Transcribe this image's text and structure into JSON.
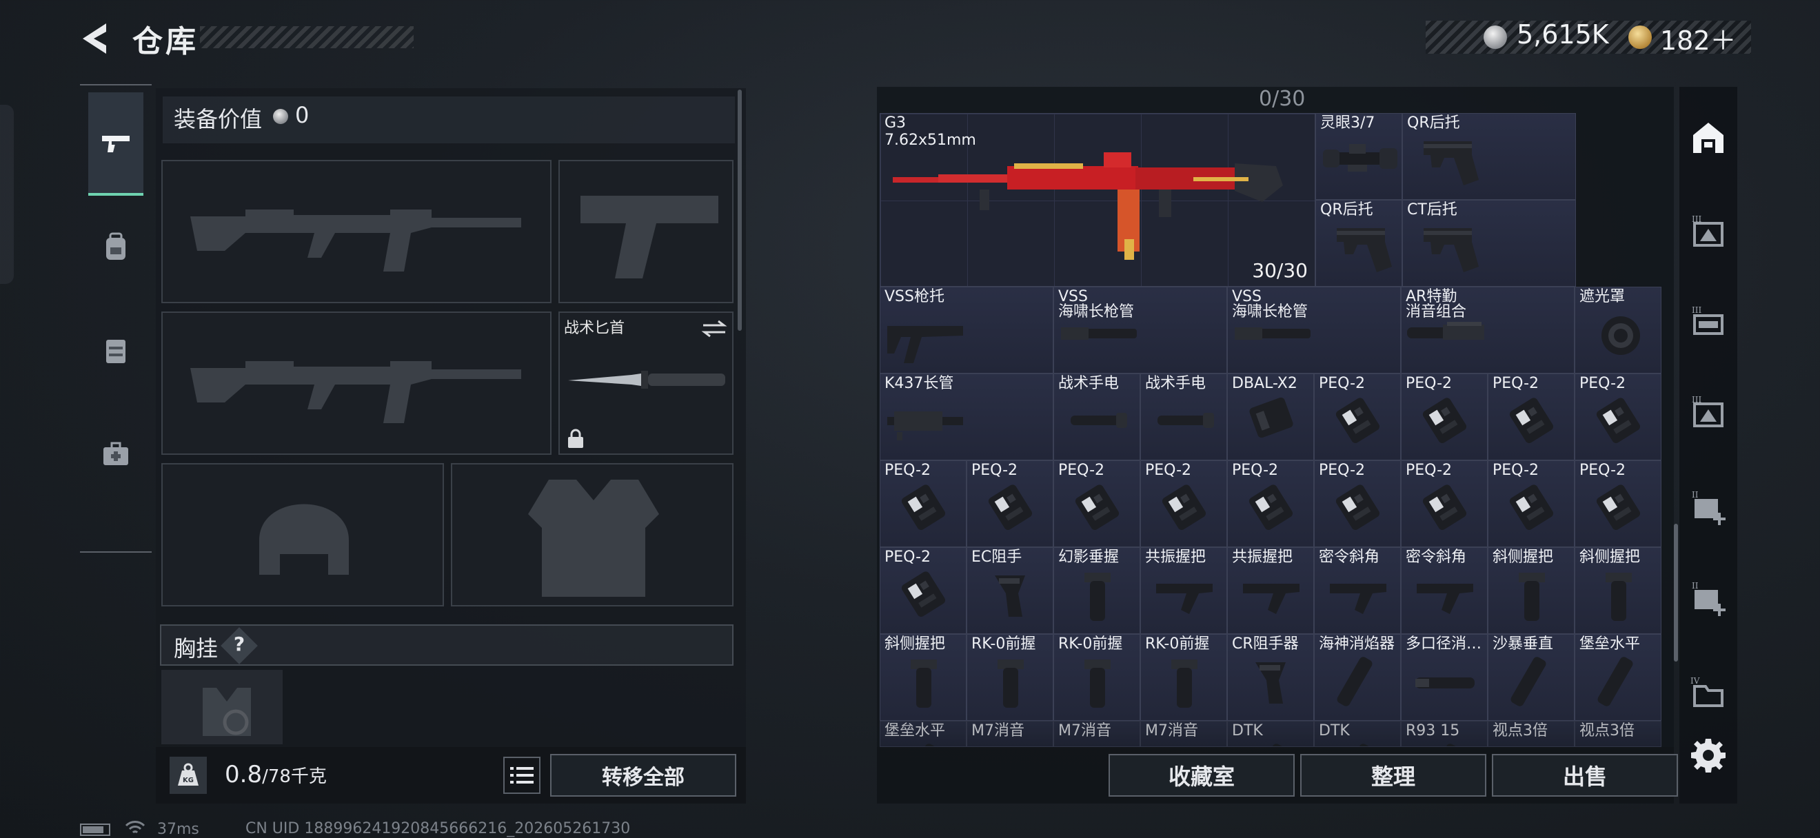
{
  "header": {
    "title": "仓库",
    "silver_amount": "5,615K",
    "gold_amount": "182＋",
    "silver_icon": "silver-coin-icon",
    "gold_icon": "gold-coin-icon"
  },
  "nav": {
    "items": [
      "pistol-icon",
      "backpack-icon",
      "rig-icon",
      "medkit-icon"
    ],
    "active": "pistol-icon"
  },
  "loadout": {
    "equip_value_label": "装备价值",
    "equip_value": "0",
    "knife_label": "战术匕首",
    "chest_label": "胸挂",
    "help_mark": "?",
    "weight_value": "0.8",
    "weight_unit": "/78千克",
    "transfer_label": "转移全部"
  },
  "stash": {
    "capacity": "0/30",
    "g3": {
      "name": "G3",
      "caliber": "7.62x51mm",
      "ammo": "30/30"
    },
    "top_cells": [
      {
        "label": "灵眼3/7",
        "icon": "scope"
      },
      {
        "label": "QR后托",
        "icon": "stock"
      },
      {
        "label": "QR后托",
        "icon": "stock"
      },
      {
        "label": "CT后托",
        "icon": "stock"
      }
    ],
    "rows": [
      [
        {
          "label": "VSS枪托",
          "icon": "vss-stock"
        },
        {
          "label": "VSS",
          "sub": "海啸长枪管",
          "icon": "barrel"
        },
        {
          "label": "VSS",
          "sub": "海啸长枪管",
          "icon": "barrel"
        },
        {
          "label": "AR特勤",
          "sub": "消音组合",
          "icon": "suppressor-rail"
        },
        {
          "label": "遮光罩",
          "icon": "lens-hood"
        }
      ],
      [
        {
          "label": "K437长管",
          "icon": "long-barrel"
        },
        {
          "label": "战术手电",
          "icon": "flashlight"
        },
        {
          "label": "战术手电",
          "icon": "flashlight"
        },
        {
          "label": "DBAL-X2",
          "icon": "laser"
        },
        {
          "label": "PEQ-2",
          "icon": "peq"
        },
        {
          "label": "PEQ-2",
          "icon": "peq"
        },
        {
          "label": "PEQ-2",
          "icon": "peq"
        },
        {
          "label": "PEQ-2",
          "icon": "peq"
        }
      ],
      [
        {
          "label": "PEQ-2",
          "icon": "peq"
        },
        {
          "label": "PEQ-2",
          "icon": "peq"
        },
        {
          "label": "PEQ-2",
          "icon": "peq"
        },
        {
          "label": "PEQ-2",
          "icon": "peq"
        },
        {
          "label": "PEQ-2",
          "icon": "peq"
        },
        {
          "label": "PEQ-2",
          "icon": "peq"
        },
        {
          "label": "PEQ-2",
          "icon": "peq"
        },
        {
          "label": "PEQ-2",
          "icon": "peq"
        },
        {
          "label": "PEQ-2",
          "icon": "peq"
        }
      ],
      [
        {
          "label": "PEQ-2",
          "icon": "peq"
        },
        {
          "label": "EC阻手",
          "icon": "hand-stop"
        },
        {
          "label": "幻影垂握",
          "icon": "vertical-grip"
        },
        {
          "label": "共振握把",
          "icon": "angled-grip"
        },
        {
          "label": "共振握把",
          "icon": "angled-grip"
        },
        {
          "label": "密令斜角",
          "icon": "angled-grip"
        },
        {
          "label": "密令斜角",
          "icon": "angled-grip"
        },
        {
          "label": "斜侧握把",
          "icon": "vertical-grip"
        },
        {
          "label": "斜侧握把",
          "icon": "vertical-grip"
        }
      ],
      [
        {
          "label": "斜侧握把",
          "icon": "vertical-grip"
        },
        {
          "label": "RK-0前握",
          "icon": "vertical-grip"
        },
        {
          "label": "RK-0前握",
          "icon": "vertical-grip"
        },
        {
          "label": "RK-0前握",
          "icon": "vertical-grip"
        },
        {
          "label": "CR阻手器",
          "icon": "hand-stop"
        },
        {
          "label": "海神消焰器",
          "icon": "muzzle"
        },
        {
          "label": "多口径消…",
          "icon": "suppressor"
        },
        {
          "label": "沙暴垂直",
          "icon": "muzzle"
        },
        {
          "label": "堡垒水平",
          "icon": "muzzle"
        }
      ],
      [
        {
          "label": "堡垒水平",
          "icon": "muzzle"
        },
        {
          "label": "M7消音",
          "icon": "suppressor"
        },
        {
          "label": "M7消音",
          "icon": "suppressor"
        },
        {
          "label": "M7消音",
          "icon": "suppressor"
        },
        {
          "label": "DTK",
          "icon": "muzzle"
        },
        {
          "label": "DTK",
          "icon": "muzzle"
        },
        {
          "label": "R93 15",
          "icon": "muzzle"
        },
        {
          "label": "视点3倍",
          "icon": "scope"
        },
        {
          "label": "视点3倍",
          "icon": "scope"
        }
      ]
    ],
    "actions": [
      "收藏室",
      "整理",
      "出售"
    ]
  },
  "rail": {
    "items": [
      "stash-home-icon",
      "container-3-icon",
      "container-3b-icon",
      "container-3c-icon",
      "container-add-2-icon",
      "container-add-2b-icon",
      "container-4-icon"
    ],
    "settings_icon": "gear-icon"
  },
  "status": {
    "ping": "37ms",
    "uid": "CN UID 1889962419208456662​16_202605261730"
  }
}
